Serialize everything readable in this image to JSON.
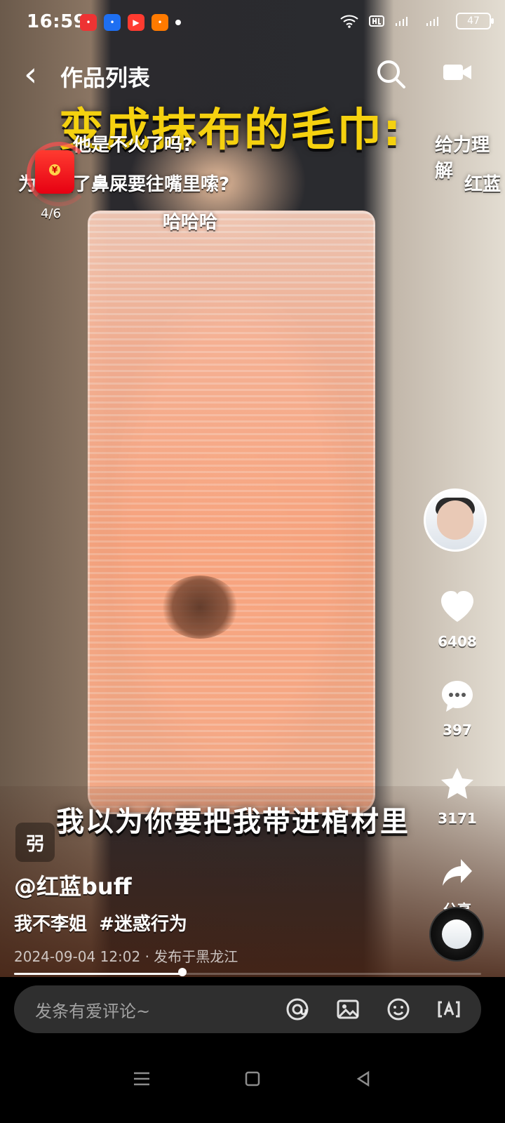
{
  "status_bar": {
    "time": "16:59",
    "battery": "47"
  },
  "top_bar": {
    "title": "作品列表",
    "overlay_headline": "变成抹布的毛巾:"
  },
  "danmaku": [
    {
      "text": "他是不火了吗?"
    },
    {
      "text": "为了抠了鼻屎要往嘴里嗦?"
    },
    {
      "text": "哈哈哈"
    },
    {
      "text": "给力理解"
    },
    {
      "text": "红蓝"
    }
  ],
  "red_packet": {
    "count": "4/6"
  },
  "right_rail": {
    "likes": "6408",
    "comments": "397",
    "favorites": "3171",
    "share_label": "分享"
  },
  "video_overlay": {
    "subtitle": "我以为你要把我带进棺材里",
    "left_tag": "弜"
  },
  "post": {
    "author": "@红蓝buff",
    "desc_prefix": "我不李姐",
    "hashtag": "#迷惑行为",
    "meta": "2024-09-04 12:02 · 发布于黑龙江"
  },
  "progress": {
    "value": 0.36
  },
  "comment": {
    "placeholder": "发条有爱评论~"
  },
  "colors": {
    "headline_yellow": "#F5D10F",
    "redpacket_red": "#E60012",
    "bottom_bg": "#000000",
    "comment_bg": "#2F2F2F"
  },
  "icons": {
    "back": "chevron-left-icon",
    "search": "search-icon",
    "video": "video-icon",
    "heart": "heart-icon",
    "comment": "comment-bubble-icon",
    "star": "star-icon",
    "share": "share-arrow-icon",
    "at": "at-icon",
    "image": "image-icon",
    "emoji": "emoji-icon",
    "ai": "ai-icon",
    "nav_menu": "menu-icon",
    "nav_home": "home-square-icon",
    "nav_back": "back-triangle-icon"
  }
}
